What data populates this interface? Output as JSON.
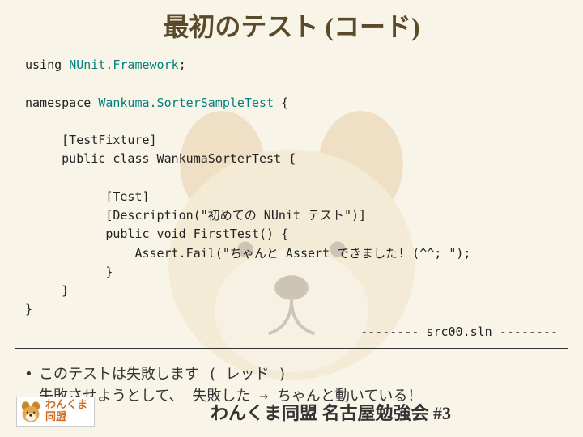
{
  "title": "最初のテスト (コード)",
  "code": {
    "l1a": "using ",
    "l1b": "NUnit.Framework",
    "l1c": ";",
    "l2a": "namespace ",
    "l2b": "Wankuma.SorterSampleTest",
    "l2c": " {",
    "l3": "     [TestFixture]",
    "l4": "     public class WankumaSorterTest {",
    "l5": "           [Test]",
    "l6": "           [Description(\"初めての NUnit テスト\")]",
    "l7": "           public void FirstTest() {",
    "l8": "               Assert.Fail(\"ちゃんと Assert できました! (^^; \");",
    "l9": "           }",
    "l10": "     }",
    "l11": "}",
    "src": "-------- src00.sln --------"
  },
  "bullets": {
    "line1": "このテストは失敗します ( レッド )",
    "line2": "失敗させようとして、 失敗した → ちゃんと動いている！"
  },
  "logo": {
    "line1": "わんくま",
    "line2": "同盟"
  },
  "footer": "わんくま同盟 名古屋勉強会 #3"
}
